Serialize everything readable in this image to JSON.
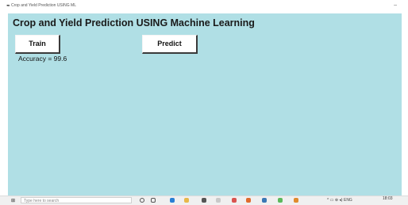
{
  "window": {
    "title": "Crop and Yield Prediction USING ML",
    "minimize_glyph": "–",
    "app_icon": "feather-icon"
  },
  "app": {
    "heading": "Crop and Yield Prediction USING Machine Learning",
    "train_label": "Train",
    "predict_label": "Predict",
    "accuracy_text": "Accuracy = 99.6",
    "background_color": "#b0dfe5"
  },
  "taskbar": {
    "search_placeholder": "Type here to search",
    "time": "18:03",
    "tray_text": "^ ▭ ⊕ ◂) ENG",
    "pinned_icons": [
      "cortana-icon",
      "task-view-icon",
      "edge-icon",
      "explorer-icon",
      "store-icon",
      "mail-icon",
      "chrome-icon",
      "office-icon",
      "python-icon",
      "app-icon"
    ]
  }
}
